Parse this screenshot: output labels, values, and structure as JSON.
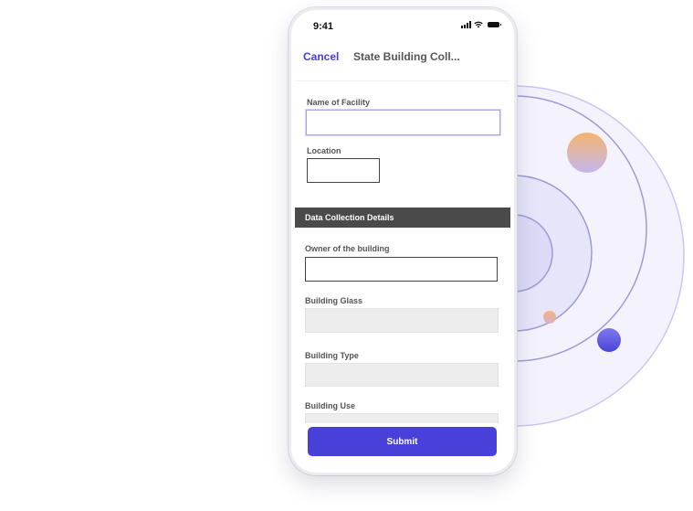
{
  "status_bar": {
    "time": "9:41",
    "icons": [
      "signal-icon",
      "wifi-icon",
      "battery-icon"
    ]
  },
  "nav": {
    "cancel_label": "Cancel",
    "title": "State Building Coll..."
  },
  "form": {
    "facility_label": "Name of Facility",
    "facility_value": "",
    "location_label": "Location",
    "location_value": "",
    "section_title": "Data Collection Details",
    "owner_label": "Owner of the building",
    "owner_value": "",
    "glass_label": "Building Glass",
    "type_label": "Building Type",
    "use_label": "Building Use"
  },
  "submit_label": "Submit",
  "colors": {
    "accent": "#4840d8",
    "section_header": "#4a4a4a",
    "orbit_peach": "#f4b97c",
    "orbit_lavender": "#b8b5ef",
    "orbit_blue": "#5a56e0"
  }
}
